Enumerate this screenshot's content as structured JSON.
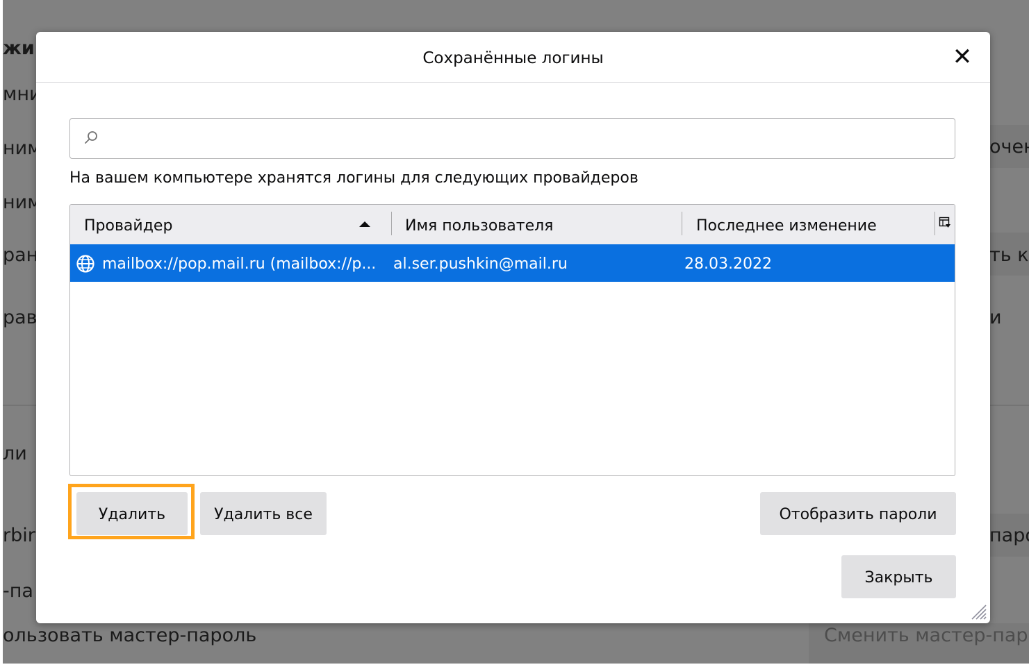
{
  "background": {
    "fragments": {
      "f1": "жи",
      "f2": "мнит",
      "f3": "ним",
      "f4": "ним",
      "f5": "ран",
      "f6": "рав",
      "f7": "ли",
      "f8": "rbir",
      "f9": "-па",
      "f10": "ользовать мастер-пароль",
      "r1": "очен",
      "r2": "ть ку",
      "r3": "и",
      "r4": "паро",
      "change_master_password": "Сменить мастер-пароль"
    }
  },
  "dialog": {
    "title": "Сохранённые логины",
    "close_symbol": "✕",
    "search": {
      "placeholder": "",
      "value": ""
    },
    "description": "На вашем компьютере хранятся логины для следующих провайдеров",
    "table": {
      "columns": {
        "provider": "Провайдер",
        "username": "Имя пользователя",
        "last_changed": "Последнее изменение"
      },
      "sort_column": "provider",
      "sort_direction": "ascending",
      "rows": [
        {
          "provider": "mailbox://pop.mail.ru (mailbox://p...",
          "username": "al.ser.pushkin@mail.ru",
          "last_changed": "28.03.2022",
          "selected": true
        }
      ]
    },
    "buttons": {
      "delete": "Удалить",
      "delete_all": "Удалить все",
      "show_passwords": "Отобразить пароли",
      "close": "Закрыть"
    },
    "highlight_color": "#ffa41c",
    "selection_color": "#0a70e0"
  }
}
